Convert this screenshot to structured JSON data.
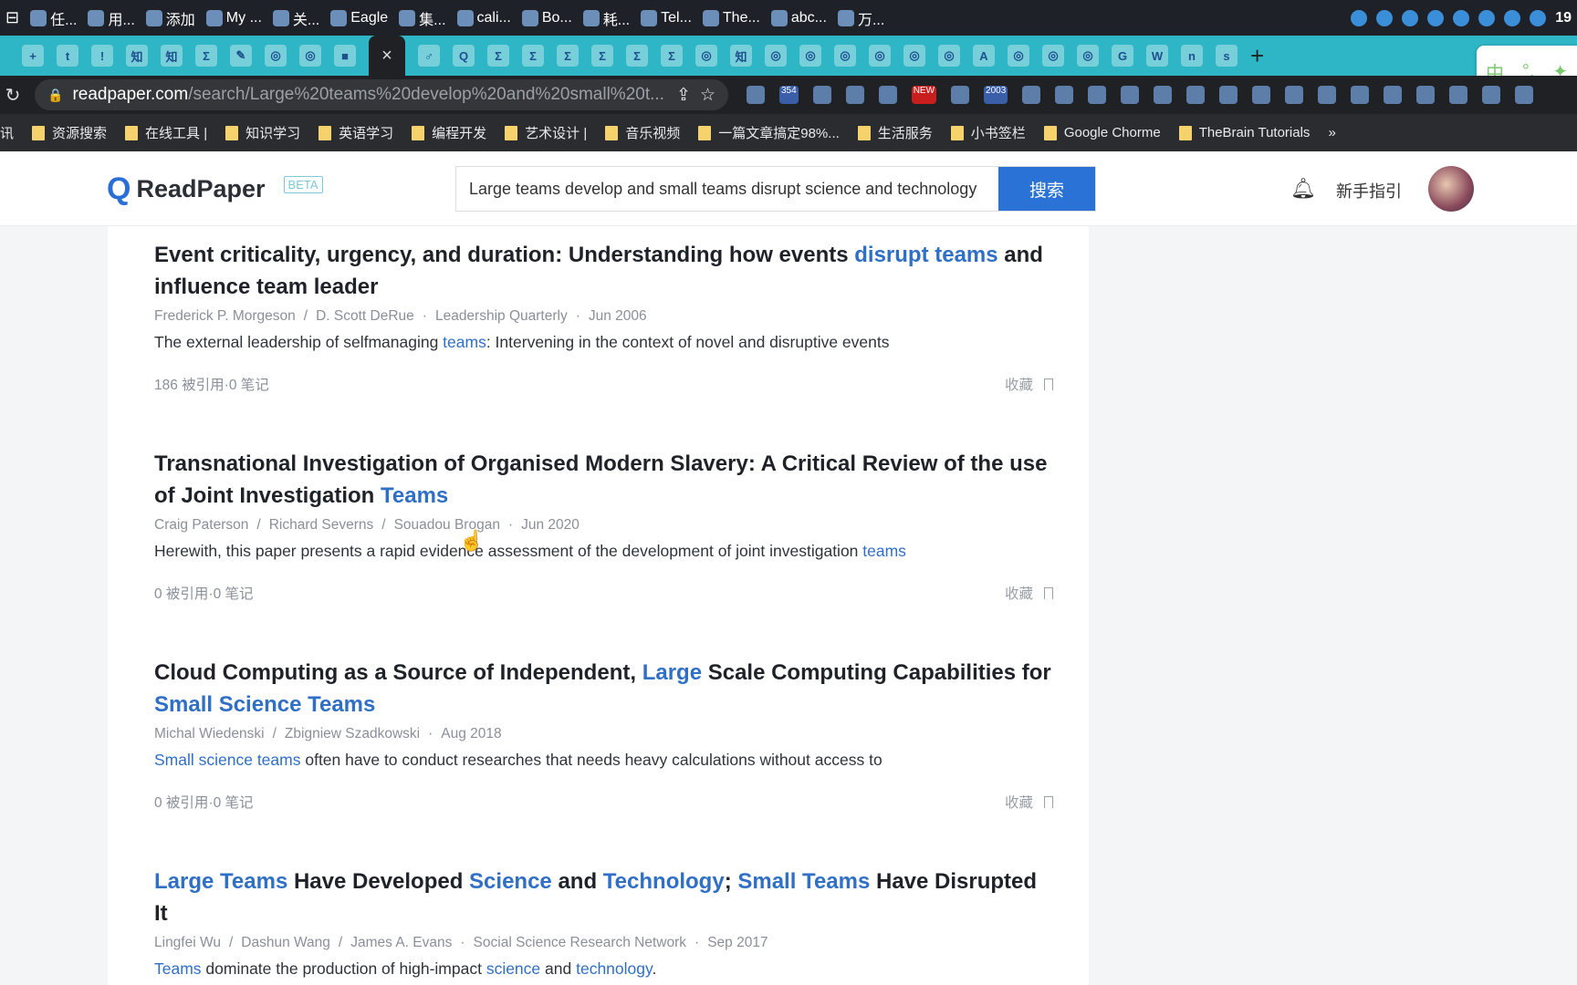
{
  "taskbar": {
    "items": [
      "任...",
      "用...",
      "添加",
      "My ...",
      "关...",
      "Eagle",
      "集...",
      "cali...",
      "Bo...",
      "耗...",
      "Tel...",
      "The...",
      "abc...",
      "万..."
    ],
    "clock": "19"
  },
  "tabs": {
    "favicons": [
      "+",
      "t",
      "!",
      "知",
      "知",
      "Σ",
      "✎",
      "◎",
      "◎",
      "■",
      "♂",
      "Q",
      "Σ",
      "Σ",
      "Σ",
      "Σ",
      "Σ",
      "Σ",
      "◎",
      "知",
      "◎",
      "◎",
      "◎",
      "◎",
      "◎",
      "◎",
      "A",
      "◎",
      "◎",
      "◎",
      "G",
      "W",
      "n",
      "s"
    ],
    "active_close": "×",
    "new_tab": "+"
  },
  "ime": {
    "label1": "中",
    "label2": "°,",
    "label3": "✦"
  },
  "address": {
    "host": "readpaper.com",
    "path": "/search/Large%20teams%20develop%20and%20small%20t...",
    "ext_badges": [
      "354",
      "NEW",
      "2003"
    ]
  },
  "bookmarks": [
    "讯",
    "资源搜索",
    "在线工具 |",
    "知识学习",
    "英语学习",
    "编程开发",
    "艺术设计 |",
    "音乐视频",
    "一篇文章搞定98%...",
    "生活服务",
    "小书签栏",
    "Google Chorme",
    "TheBrain Tutorials"
  ],
  "header": {
    "logo": "ReadPaper",
    "beta": "BETA",
    "search_value": "Large teams develop and small teams disrupt science and technology",
    "search_button": "搜索",
    "guide": "新手指引"
  },
  "colors": {
    "accent": "#2a72d6",
    "highlight": "#2f6fc6",
    "tabbar": "#2fb6c6"
  },
  "results": [
    {
      "title": [
        {
          "t": "Event criticality, urgency, and duration: Understanding how events "
        },
        {
          "t": "disrupt teams",
          "hl": true
        },
        {
          "t": " and influence team leader"
        }
      ],
      "meta": [
        "Frederick P. Morgeson",
        "/",
        "D. Scott DeRue",
        "·",
        "Leadership Quarterly",
        "·",
        "Jun 2006"
      ],
      "snippet": [
        {
          "t": "The external leadership of selfmanaging "
        },
        {
          "t": "teams",
          "hl": true
        },
        {
          "t": ": Intervening in the context of novel and disruptive events"
        }
      ],
      "citations": "186 被引用",
      "notes": "0 笔记",
      "fav": "收藏"
    },
    {
      "title": [
        {
          "t": "Transnational Investigation of Organised Modern Slavery: A Critical Review of the use of Joint Investigation "
        },
        {
          "t": "Teams",
          "hl": true
        }
      ],
      "meta": [
        "Craig Paterson",
        "/",
        "Richard Severns",
        "/",
        "Souadou Brogan",
        "·",
        "Jun 2020"
      ],
      "snippet": [
        {
          "t": "Herewith, this paper presents a rapid evidence assessment of the development of joint investigation "
        },
        {
          "t": "teams",
          "hl": true
        }
      ],
      "citations": "0 被引用",
      "notes": "0 笔记",
      "fav": "收藏"
    },
    {
      "title": [
        {
          "t": "Cloud Computing as a Source of Independent, "
        },
        {
          "t": "Large",
          "hl": true
        },
        {
          "t": " Scale Computing Capabilities for "
        },
        {
          "t": "Small Science Teams",
          "hl": true
        }
      ],
      "meta": [
        "Michal Wiedenski",
        "/",
        "Zbigniew Szadkowski",
        "·",
        "Aug 2018"
      ],
      "snippet": [
        {
          "t": "Small science teams",
          "hl": true
        },
        {
          "t": " often have to conduct researches that needs heavy calculations without access to"
        }
      ],
      "citations": "0 被引用",
      "notes": "0 笔记",
      "fav": "收藏"
    },
    {
      "title": [
        {
          "t": "Large Teams",
          "hl": true
        },
        {
          "t": " Have Developed "
        },
        {
          "t": "Science",
          "hl": true
        },
        {
          "t": " and "
        },
        {
          "t": "Technology",
          "hl": true
        },
        {
          "t": "; "
        },
        {
          "t": "Small Teams",
          "hl": true
        },
        {
          "t": " Have Disrupted It"
        }
      ],
      "meta": [
        "Lingfei Wu",
        "/",
        "Dashun Wang",
        "/",
        "James A. Evans",
        "·",
        "Social Science Research Network",
        "·",
        "Sep 2017"
      ],
      "snippet": [
        {
          "t": "Teams",
          "hl": true
        },
        {
          "t": " dominate the production of high-impact "
        },
        {
          "t": "science",
          "hl": true
        },
        {
          "t": " and "
        },
        {
          "t": "technology",
          "hl": true
        },
        {
          "t": "."
        }
      ]
    }
  ]
}
